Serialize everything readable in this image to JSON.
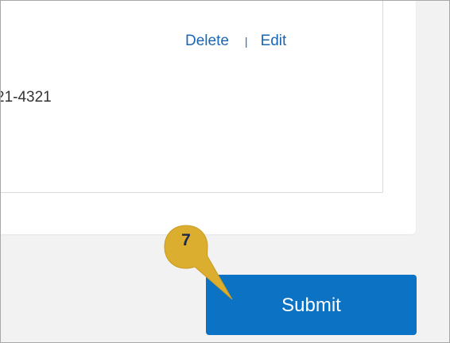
{
  "card": {
    "delete_label": "Delete",
    "separator": "|",
    "edit_label": "Edit",
    "phone_fragment": "21-4321"
  },
  "submit": {
    "label": "Submit"
  },
  "callout": {
    "number": "7",
    "color": "#dcae30"
  },
  "colors": {
    "link": "#1a66b3",
    "button": "#0b72c4",
    "background": "#f2f2f2"
  }
}
